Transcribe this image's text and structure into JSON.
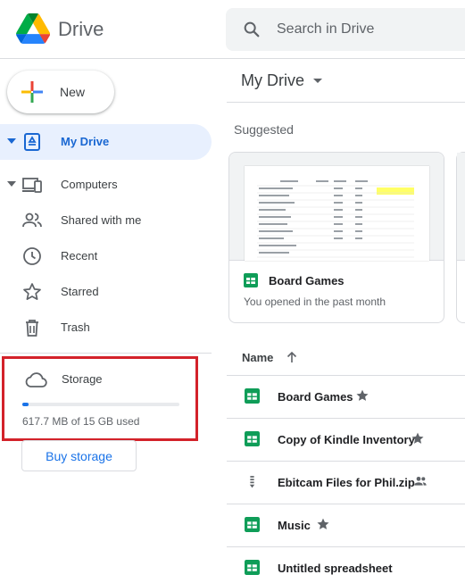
{
  "app": {
    "title": "Drive"
  },
  "search": {
    "placeholder": "Search in Drive",
    "icon": "search-icon"
  },
  "new_button": {
    "label": "New"
  },
  "sidebar": {
    "items": [
      {
        "label": "My Drive",
        "icon": "my-drive-icon",
        "active": true,
        "expandable": true
      },
      {
        "label": "Computers",
        "icon": "computers-icon",
        "active": false,
        "expandable": true
      },
      {
        "label": "Shared with me",
        "icon": "shared-icon",
        "active": false
      },
      {
        "label": "Recent",
        "icon": "clock-icon",
        "active": false
      },
      {
        "label": "Starred",
        "icon": "star-icon",
        "active": false
      },
      {
        "label": "Trash",
        "icon": "trash-icon",
        "active": false
      }
    ],
    "storage": {
      "label": "Storage",
      "used_text": "617.7 MB of 15 GB used",
      "used_fraction": 0.04,
      "buy_label": "Buy storage"
    }
  },
  "main": {
    "title": "My Drive",
    "suggested_label": "Suggested",
    "suggested": [
      {
        "name": "Board Games",
        "subtitle": "You opened in the past month",
        "type": "sheet"
      }
    ],
    "list_header": {
      "name": "Name"
    },
    "files": [
      {
        "name": "Board Games",
        "type": "sheet",
        "starred": true,
        "shared": false
      },
      {
        "name": "Copy of Kindle Inventory",
        "type": "sheet",
        "starred": true,
        "shared": false
      },
      {
        "name": "Ebitcam Files for Phil.zip",
        "type": "zip",
        "starred": false,
        "shared": true
      },
      {
        "name": "Music",
        "type": "sheet",
        "starred": true,
        "shared": false
      },
      {
        "name": "Untitled spreadsheet",
        "type": "sheet",
        "starred": false,
        "shared": false
      }
    ]
  },
  "colors": {
    "accent": "#1a73e8",
    "active_bg": "#e8f0fe",
    "active_text": "#1967d2",
    "sheets_green": "#0f9d58",
    "highlight_red": "#d3222a"
  }
}
